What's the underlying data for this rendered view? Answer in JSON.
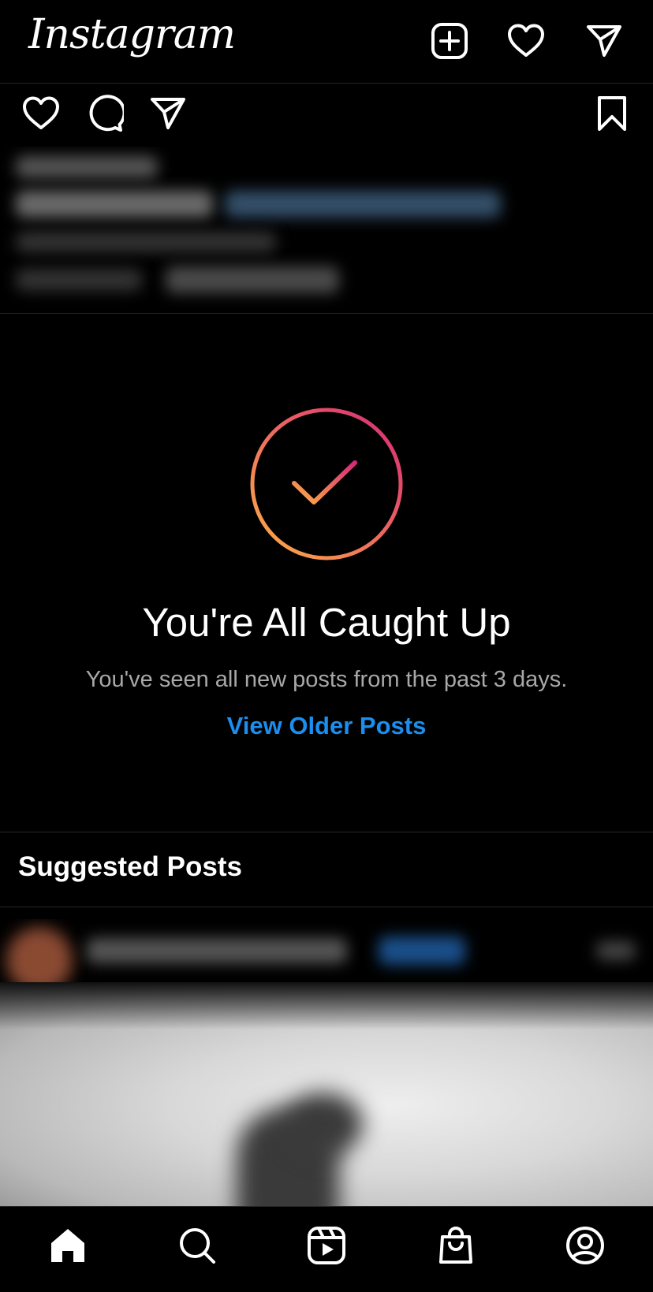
{
  "header": {
    "logo_text": "Instagram",
    "icons": [
      "new-post-icon",
      "heart-icon",
      "direct-message-icon"
    ]
  },
  "post_actions": {
    "icons": [
      "like-icon",
      "comment-icon",
      "share-icon",
      "save-bookmark-icon"
    ]
  },
  "caught_up": {
    "title": "You're All Caught Up",
    "subtitle": "You've seen all new posts from the past 3 days.",
    "link": "View Older Posts"
  },
  "suggested": {
    "title": "Suggested Posts"
  },
  "tabbar": {
    "icons": [
      "home-icon",
      "search-icon",
      "reels-icon",
      "shop-icon",
      "profile-icon"
    ]
  },
  "colors": {
    "background": "#000000",
    "link": "#1a8ff0",
    "muted_text": "#a8a8a8",
    "gradient_start": "#d62976",
    "gradient_end": "#fcaf45"
  }
}
